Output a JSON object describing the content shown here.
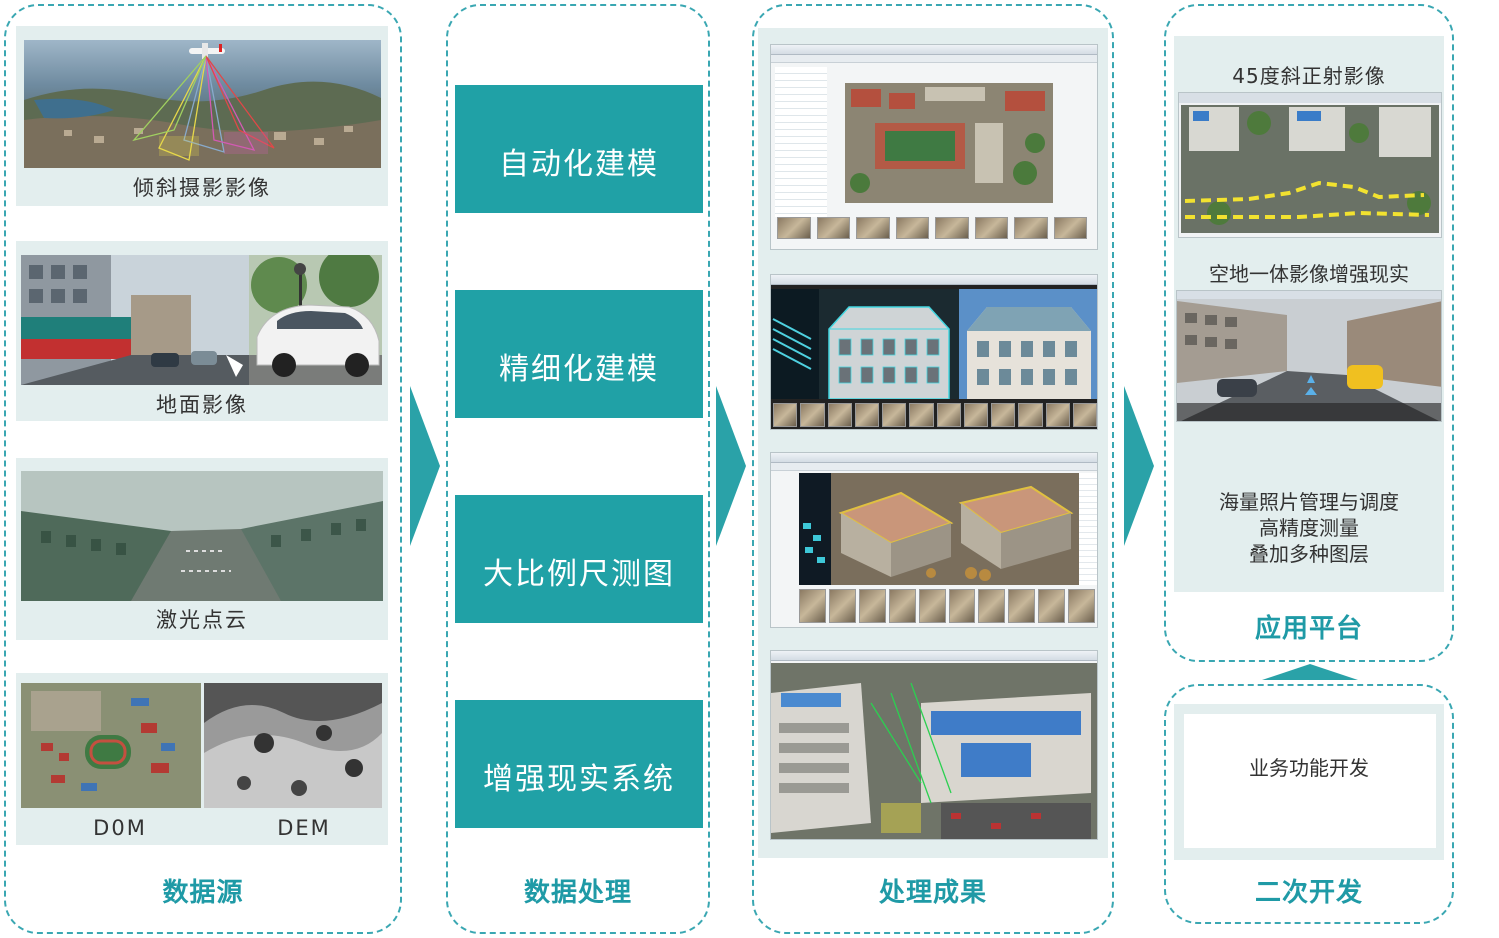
{
  "columns": {
    "source": {
      "title": "数据源",
      "items": [
        {
          "label": "倾斜摄影影像"
        },
        {
          "label": "地面影像"
        },
        {
          "label": "激光点云"
        },
        {
          "label_left": "D0M",
          "label_right": "DEM"
        }
      ]
    },
    "processing": {
      "title": "数据处理",
      "steps": [
        "自动化建模",
        "精细化建模",
        "大比例尺测图",
        "增强现实系统"
      ]
    },
    "results": {
      "title": "处理成果"
    },
    "platform": {
      "title": "应用平台",
      "image_caption_1": "45度斜正射影像",
      "image_caption_2": "空地一体影像增强现实",
      "features": [
        "海量照片管理与调度",
        "高精度测量",
        "叠加多种图层"
      ]
    },
    "development": {
      "title": "二次开发",
      "box_label": "业务功能开发"
    }
  },
  "colors": {
    "accent": "#20a1a6",
    "title": "#1f9aa6",
    "panel_border": "#3aa7b2",
    "card_bg": "#e3eeee"
  }
}
